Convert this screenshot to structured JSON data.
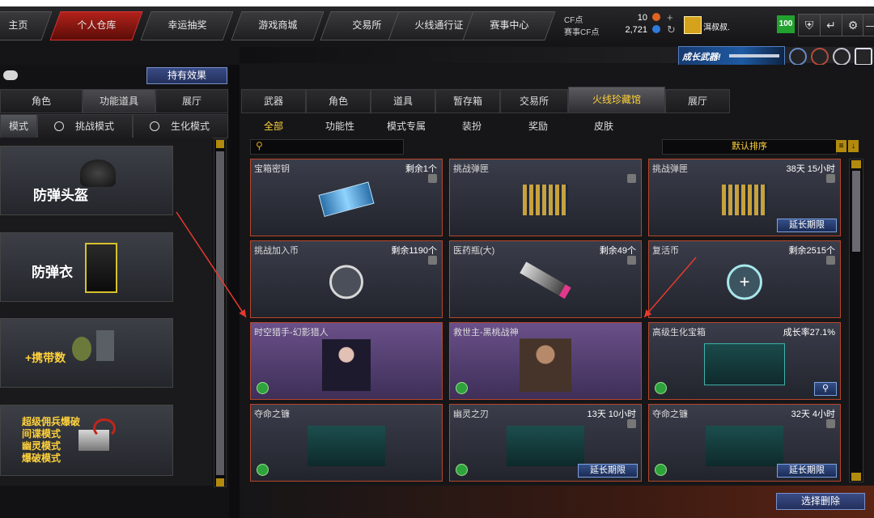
{
  "topnav": {
    "items": [
      "主页",
      "个人仓库",
      "幸运抽奖",
      "游戏商城",
      "交易所",
      "火线通行证",
      "赛事中心"
    ],
    "active_index": 1,
    "cf_label": "CF点",
    "cf_value": "10",
    "match_cf_label": "赛事CF点",
    "match_cf_value": "2,721",
    "username": "洱叔叔.",
    "level": "100"
  },
  "banner": {
    "text": "成长武器!"
  },
  "left": {
    "effects_button": "持有效果",
    "tabs": [
      "角色",
      "功能道具",
      "展厅"
    ],
    "active_tab": 1,
    "modes": [
      "模式",
      "挑战模式",
      "生化模式"
    ],
    "items": [
      {
        "label": "防弹头盔"
      },
      {
        "label": "防弹衣"
      },
      {
        "label": "+携带数"
      },
      {
        "label": "超级佣兵爆破\n间谍模式\n幽灵模式\n爆破模式"
      }
    ]
  },
  "right": {
    "tabs": [
      "武器",
      "角色",
      "道具",
      "暂存箱",
      "交易所",
      "火线珍藏馆",
      "展厅"
    ],
    "active_tab": 5,
    "subtabs": [
      "全部",
      "功能性",
      "模式专属",
      "装扮",
      "奖励",
      "皮肤"
    ],
    "active_subtab": 0,
    "sort_label": "默认排序",
    "search_placeholder": "",
    "delete_button": "选择删除",
    "extend_label": "延长期限",
    "cards": [
      {
        "name": "宝箱密钥",
        "status": "剩余1个",
        "style": "normal",
        "trash": true,
        "extend": false,
        "green": false,
        "art": "key"
      },
      {
        "name": "挑战弹匣",
        "status": "",
        "style": "normal",
        "trash": true,
        "extend": false,
        "green": false,
        "art": "ammo"
      },
      {
        "name": "挑战弹匣",
        "status": "38天 15小时",
        "style": "normal",
        "trash": true,
        "extend": true,
        "green": false,
        "art": "ammo"
      },
      {
        "name": "挑战加入币",
        "status": "剩余1190个",
        "style": "normal",
        "trash": true,
        "extend": false,
        "green": false,
        "art": "coin"
      },
      {
        "name": "医药瓶(大)",
        "status": "剩余49个",
        "style": "normal",
        "trash": true,
        "extend": false,
        "green": false,
        "art": "gun"
      },
      {
        "name": "复活币",
        "status": "剩余2515个",
        "style": "normal",
        "trash": true,
        "extend": false,
        "green": false,
        "art": "revive"
      },
      {
        "name": "时空猎手-幻影猎人",
        "status": "",
        "style": "purple",
        "trash": false,
        "extend": false,
        "green": true,
        "art": "hunter"
      },
      {
        "name": "救世主-黑桃战神",
        "status": "",
        "style": "purple",
        "trash": false,
        "extend": false,
        "green": true,
        "art": "soldier"
      },
      {
        "name": "高级生化宝箱",
        "status": "成长率27.1%",
        "style": "normal",
        "trash": false,
        "extend": false,
        "green": true,
        "art": "box",
        "search": true
      },
      {
        "name": "夺命之镰",
        "status": "",
        "style": "normal",
        "trash": false,
        "extend": false,
        "green": true,
        "art": "scythe"
      },
      {
        "name": "幽灵之刃",
        "status": "13天 10小时",
        "style": "normal",
        "trash": true,
        "extend": true,
        "green": true,
        "art": "scythe"
      },
      {
        "name": "夺命之镰",
        "status": "32天 4小时",
        "style": "normal",
        "trash": true,
        "extend": true,
        "green": true,
        "art": "scythe"
      }
    ]
  }
}
